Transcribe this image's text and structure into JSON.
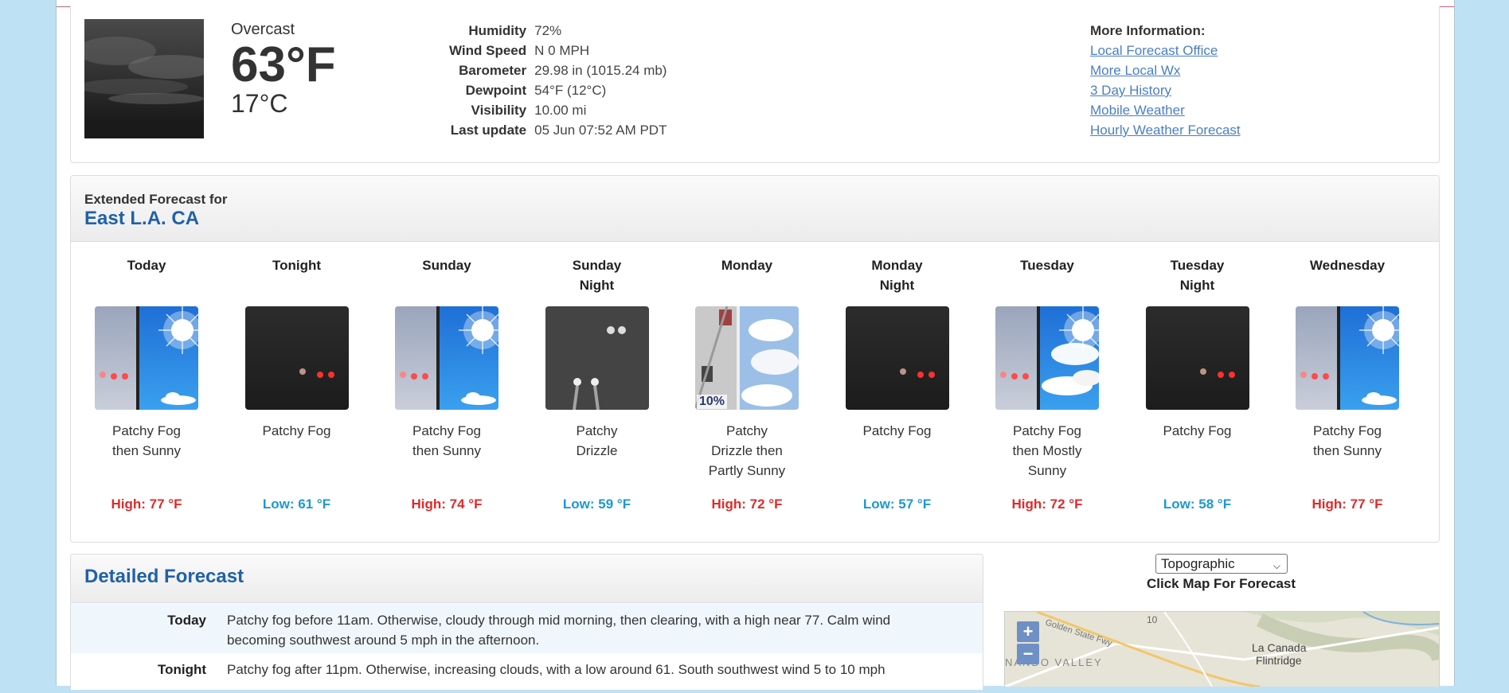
{
  "current": {
    "condition": "Overcast",
    "temp_f": "63°F",
    "temp_c": "17°C",
    "details": [
      {
        "label": "Humidity",
        "value": "72%"
      },
      {
        "label": "Wind Speed",
        "value": "N 0 MPH"
      },
      {
        "label": "Barometer",
        "value": "29.98 in (1015.24 mb)"
      },
      {
        "label": "Dewpoint",
        "value": "54°F (12°C)"
      },
      {
        "label": "Visibility",
        "value": "10.00 mi"
      },
      {
        "label": "Last update",
        "value": "05 Jun 07:52 AM PDT"
      }
    ]
  },
  "more_info": {
    "title": "More Information:",
    "links": [
      "Local Forecast Office",
      "More Local Wx",
      "3 Day History",
      "Mobile Weather",
      "Hourly Weather Forecast"
    ]
  },
  "extended": {
    "label": "Extended Forecast for",
    "location": "East L.A. CA",
    "periods": [
      {
        "name": [
          "Today"
        ],
        "icon": "fog-then-sunny-icon",
        "short": [
          "Patchy Fog",
          "then Sunny"
        ],
        "temp": "High: 77 °F",
        "kind": "hi"
      },
      {
        "name": [
          "Tonight"
        ],
        "icon": "fog-night-icon",
        "short": [
          "Patchy Fog"
        ],
        "temp": "Low: 61 °F",
        "kind": "lo"
      },
      {
        "name": [
          "Sunday"
        ],
        "icon": "fog-then-sunny-icon",
        "short": [
          "Patchy Fog",
          "then Sunny"
        ],
        "temp": "High: 74 °F",
        "kind": "hi"
      },
      {
        "name": [
          "Sunday",
          "Night"
        ],
        "icon": "drizzle-night-icon",
        "short": [
          "Patchy",
          "Drizzle"
        ],
        "temp": "Low: 59 °F",
        "kind": "lo"
      },
      {
        "name": [
          "Monday"
        ],
        "icon": "drizzle-then-partly-sunny-icon",
        "short": [
          "Patchy",
          "Drizzle then",
          "Partly Sunny"
        ],
        "temp": "High: 72 °F",
        "kind": "hi",
        "pop": "10%"
      },
      {
        "name": [
          "Monday",
          "Night"
        ],
        "icon": "fog-night-icon",
        "short": [
          "Patchy Fog"
        ],
        "temp": "Low: 57 °F",
        "kind": "lo"
      },
      {
        "name": [
          "Tuesday"
        ],
        "icon": "fog-then-mostly-sunny-icon",
        "short": [
          "Patchy Fog",
          "then Mostly",
          "Sunny"
        ],
        "temp": "High: 72 °F",
        "kind": "hi"
      },
      {
        "name": [
          "Tuesday",
          "Night"
        ],
        "icon": "fog-night-icon",
        "short": [
          "Patchy Fog"
        ],
        "temp": "Low: 58 °F",
        "kind": "lo"
      },
      {
        "name": [
          "Wednesday"
        ],
        "icon": "fog-then-sunny-icon",
        "short": [
          "Patchy Fog",
          "then Sunny"
        ],
        "temp": "High: 77 °F",
        "kind": "hi"
      }
    ]
  },
  "detailed": {
    "title": "Detailed Forecast",
    "rows": [
      {
        "label": "Today",
        "text": "Patchy fog before 11am. Otherwise, cloudy through mid morning, then clearing, with a high near 77. Calm wind becoming southwest around 5 mph in the afternoon."
      },
      {
        "label": "Tonight",
        "text": "Patchy fog after 11pm. Otherwise, increasing clouds, with a low around 61. South southwest wind 5 to 10 mph"
      }
    ]
  },
  "map": {
    "select_value": "Topographic",
    "caption": "Click Map For Forecast",
    "zoom_in": "+",
    "zoom_out": "−",
    "labels": [
      "La Canada",
      "Flintridge",
      "NANDO VALLEY",
      "Golden State Fwy",
      "10"
    ]
  },
  "colors": {
    "high": "#e02a2a",
    "low": "#1d98d4",
    "link": "#4a7fc4",
    "heading": "#2061a8"
  }
}
